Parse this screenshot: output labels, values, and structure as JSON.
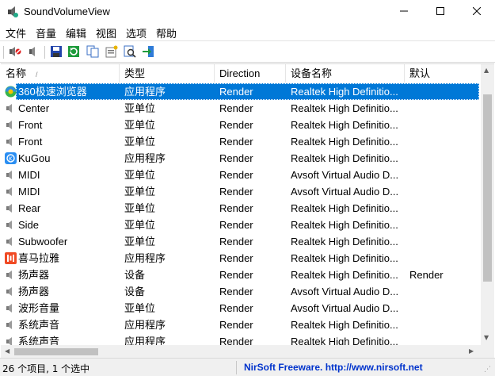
{
  "window": {
    "title": "SoundVolumeView",
    "minimize_icon": "minimize-icon",
    "maximize_icon": "maximize-icon",
    "close_icon": "close-icon"
  },
  "menu": {
    "items": [
      "文件",
      "音量",
      "编辑",
      "视图",
      "选项",
      "帮助"
    ]
  },
  "toolbar": {
    "buttons": [
      "mute-icon",
      "unmute-icon",
      "save-icon",
      "refresh-icon",
      "copy-icon",
      "properties-icon",
      "find-icon",
      "exit-icon"
    ]
  },
  "columns": [
    "名称",
    "类型",
    "Direction",
    "设备名称",
    "默认"
  ],
  "sort_indicator": "/",
  "rows": [
    {
      "icon": "360-browser-icon",
      "name": "360极速浏览器",
      "type": "应用程序",
      "direction": "Render",
      "device": "Realtek High Definitio...",
      "default": "",
      "selected": true
    },
    {
      "icon": "speaker-icon",
      "name": "Center",
      "type": "亚单位",
      "direction": "Render",
      "device": "Realtek High Definitio...",
      "default": ""
    },
    {
      "icon": "speaker-icon",
      "name": "Front",
      "type": "亚单位",
      "direction": "Render",
      "device": "Realtek High Definitio...",
      "default": ""
    },
    {
      "icon": "speaker-icon",
      "name": "Front",
      "type": "亚单位",
      "direction": "Render",
      "device": "Realtek High Definitio...",
      "default": ""
    },
    {
      "icon": "kugou-icon",
      "name": "KuGou",
      "type": "应用程序",
      "direction": "Render",
      "device": "Realtek High Definitio...",
      "default": ""
    },
    {
      "icon": "speaker-icon",
      "name": "MIDI",
      "type": "亚单位",
      "direction": "Render",
      "device": "Avsoft Virtual Audio D...",
      "default": ""
    },
    {
      "icon": "speaker-icon",
      "name": "MIDI",
      "type": "亚单位",
      "direction": "Render",
      "device": "Avsoft Virtual Audio D...",
      "default": ""
    },
    {
      "icon": "speaker-icon",
      "name": "Rear",
      "type": "亚单位",
      "direction": "Render",
      "device": "Realtek High Definitio...",
      "default": ""
    },
    {
      "icon": "speaker-icon",
      "name": "Side",
      "type": "亚单位",
      "direction": "Render",
      "device": "Realtek High Definitio...",
      "default": ""
    },
    {
      "icon": "speaker-icon",
      "name": "Subwoofer",
      "type": "亚单位",
      "direction": "Render",
      "device": "Realtek High Definitio...",
      "default": ""
    },
    {
      "icon": "ximalaya-icon",
      "name": "喜马拉雅",
      "type": "应用程序",
      "direction": "Render",
      "device": "Realtek High Definitio...",
      "default": ""
    },
    {
      "icon": "speaker-icon",
      "name": "扬声器",
      "type": "设备",
      "direction": "Render",
      "device": "Realtek High Definitio...",
      "default": "Render"
    },
    {
      "icon": "speaker-icon",
      "name": "扬声器",
      "type": "设备",
      "direction": "Render",
      "device": "Avsoft Virtual Audio D...",
      "default": ""
    },
    {
      "icon": "speaker-icon",
      "name": "波形音量",
      "type": "亚单位",
      "direction": "Render",
      "device": "Avsoft Virtual Audio D...",
      "default": ""
    },
    {
      "icon": "speaker-icon",
      "name": "系统声音",
      "type": "应用程序",
      "direction": "Render",
      "device": "Realtek High Definitio...",
      "default": ""
    },
    {
      "icon": "speaker-icon",
      "name": "系统声音",
      "type": "应用程序",
      "direction": "Render",
      "device": "Realtek High Definitio...",
      "default": ""
    }
  ],
  "status": {
    "count_text": "26 个项目, 1 个选中",
    "link_text": "NirSoft Freeware.  http://www.nirsoft.net"
  },
  "colors": {
    "selection": "#0078d7",
    "link": "#0033cc"
  }
}
